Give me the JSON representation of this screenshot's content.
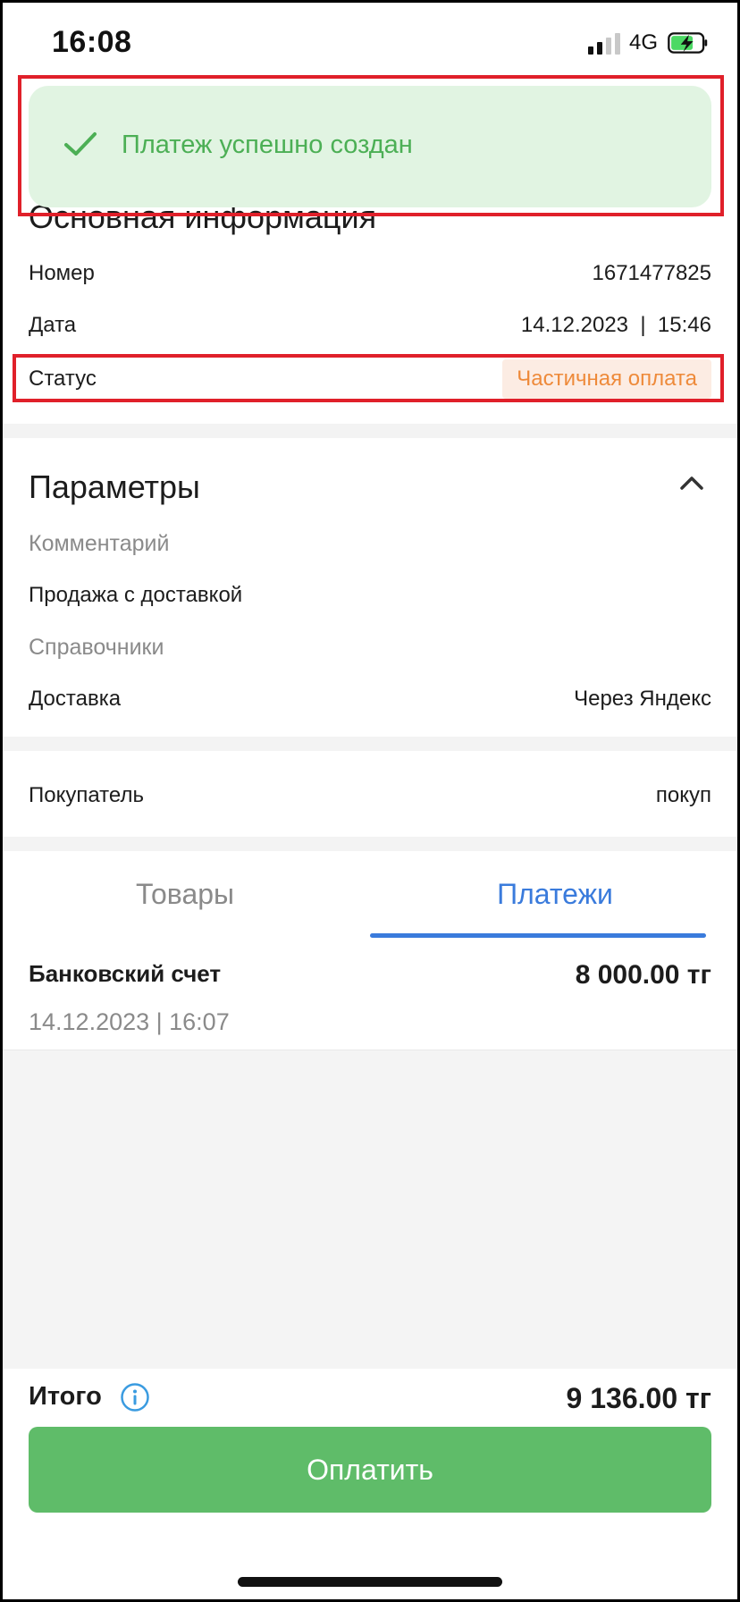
{
  "status_bar": {
    "time": "16:08",
    "network": "4G",
    "signal_level": "2 of 4"
  },
  "toast": {
    "message": "Платеж успешно создан",
    "icon": "checkmark-icon"
  },
  "main_info": {
    "title": "Основная информация",
    "number_label": "Номер",
    "number_value": "1671477825",
    "date_label": "Дата",
    "date_value": "14.12.2023  |  15:46",
    "status_label": "Статус",
    "status_value": "Частичная оплата"
  },
  "params": {
    "title": "Параметры",
    "comment_label": "Комментарий",
    "comment_value": "Продажа с доставкой",
    "directories_label": "Справочники",
    "delivery_label": "Доставка",
    "delivery_value": "Через Яндекс"
  },
  "buyer": {
    "label": "Покупатель",
    "value": "покуп"
  },
  "tabs": {
    "goods": "Товары",
    "payments": "Платежи",
    "active": "payments"
  },
  "payment": {
    "name": "Банковский счет",
    "amount": "8 000.00 тг",
    "date": "14.12.2023 | 16:07"
  },
  "footer": {
    "total_label": "Итого",
    "total_amount": "9 136.00 тг",
    "pay_button": "Оплатить"
  },
  "colors": {
    "accent_green": "#5fbc69",
    "toast_bg": "#e1f4e2",
    "status_orange": "#ee8a3a",
    "tab_blue": "#3a7bdc",
    "highlight_red": "#e0202a"
  }
}
